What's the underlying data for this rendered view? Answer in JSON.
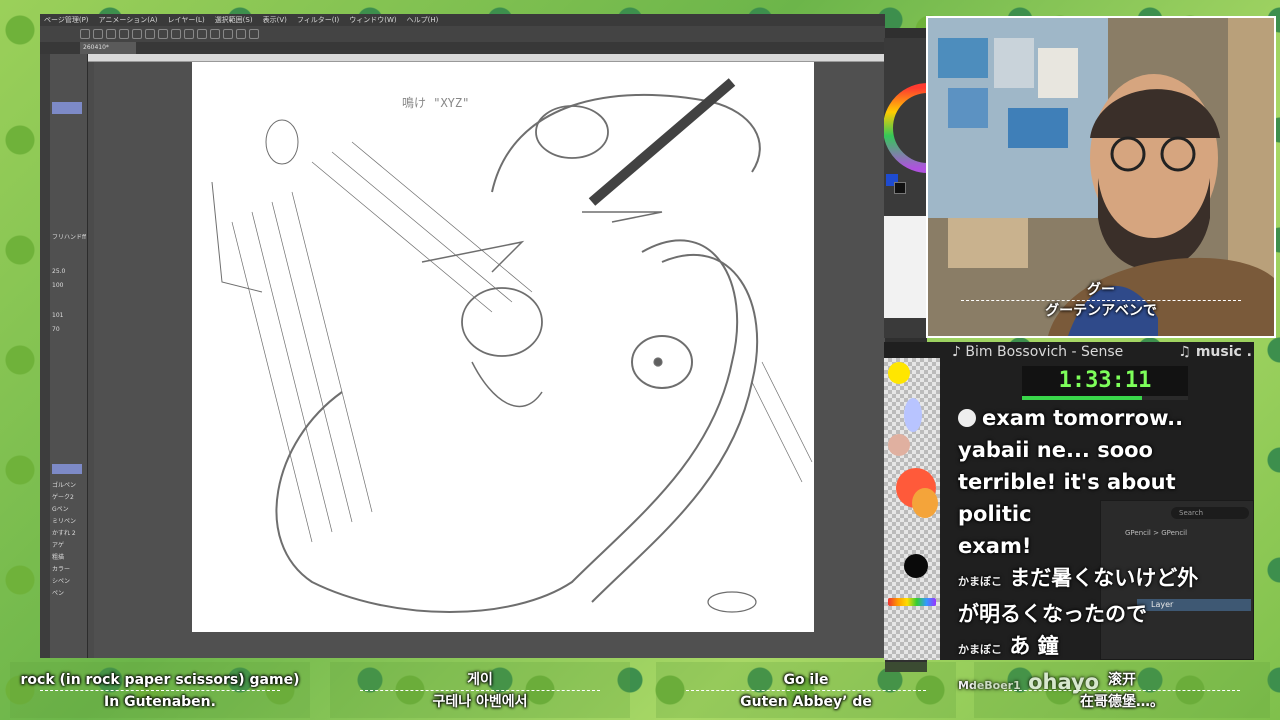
{
  "app": {
    "menu": [
      "ページ管理(P)",
      "アニメーション(A)",
      "レイヤー(L)",
      "選択範囲(S)",
      "表示(V)",
      "フィルター(I)",
      "ウィンドウ(W)",
      "ヘルプ(H)"
    ],
    "doc_tab": "260410*",
    "side_panel": [
      "フリハンドff",
      "25.0",
      "100",
      "101",
      "70"
    ],
    "tool_list": [
      "ゴルペン",
      "ゲーク2",
      "Gペン",
      "ミリペン",
      "かすれ 2",
      "アゲ",
      "粗描",
      "カラー",
      "シペン",
      "ペン"
    ],
    "sketch_text": "鳴け \"XYZ\""
  },
  "webcam": {
    "caption_line1": "グー",
    "caption_line2": "グーテンアベンで"
  },
  "music": {
    "track": "♪ Bim Bossovich - Sense",
    "label": "♫ music ."
  },
  "timer": {
    "value": "1:33:11",
    "progress": 0.72
  },
  "chat": [
    {
      "user": "",
      "text": "exam tomorrow.."
    },
    {
      "user": "",
      "text": "yabaii ne... sooo"
    },
    {
      "user": "",
      "text": "terrible! it's about politic"
    },
    {
      "user": "",
      "text": "exam!"
    },
    {
      "user": "かまぼこ",
      "text": "まだ暑くないけど外"
    },
    {
      "user": "",
      "text": "が明るくなったので"
    },
    {
      "user": "かまぼこ",
      "text": "あ 鐘"
    },
    {
      "user": "MdeBoer1",
      "text": "ohayo"
    }
  ],
  "blender": {
    "search_placeholder": "Search",
    "breadcrumb": "GPencil > GPencil",
    "layer_label": "Layer"
  },
  "subtitles": [
    {
      "line1": "rock (in rock paper scissors) game)",
      "line2": "In Gutenaben."
    },
    {
      "line1": "게이",
      "line2": "구테나 아벤에서"
    },
    {
      "line1": "Go ile",
      "line2": "Guten Abbey’ de"
    },
    {
      "line1": "滚开",
      "line2": "在哥德堡…。"
    }
  ],
  "colors": {
    "timer_text": "#7dff5a",
    "accent_selected": "#7d8ac7",
    "layer_highlight": "#3e5873"
  }
}
